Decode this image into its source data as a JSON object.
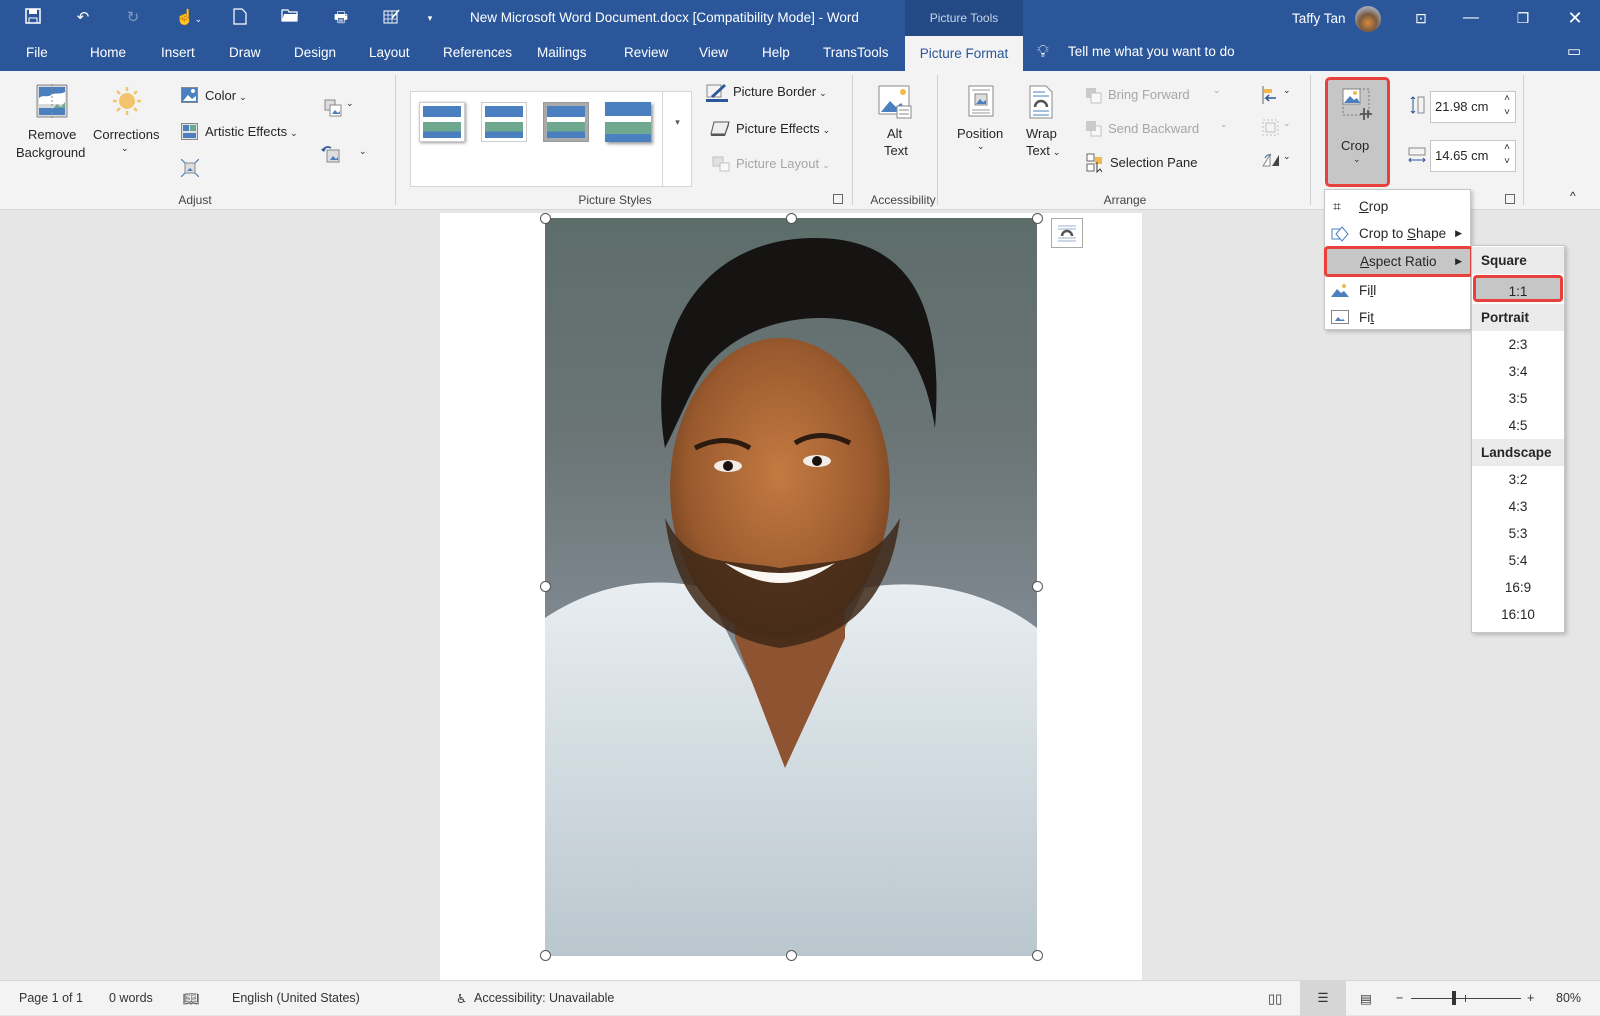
{
  "window": {
    "title": "New Microsoft Word Document.docx [Compatibility Mode]  -  Word",
    "context_tab_group": "Picture Tools",
    "user_name": "Taffy Tan"
  },
  "quick_access": [
    "save-icon",
    "undo-icon",
    "redo-icon",
    "touch-mode-icon",
    "new-document-icon",
    "open-icon",
    "print-preview-icon",
    "edit-data-icon",
    "customize-qat-icon"
  ],
  "tabs": [
    "File",
    "Home",
    "Insert",
    "Draw",
    "Design",
    "Layout",
    "References",
    "Mailings",
    "Review",
    "View",
    "Help",
    "TransTools"
  ],
  "active_tab": "Picture Format",
  "tell_me": "Tell me what you want to do",
  "ribbon": {
    "adjust": {
      "label": "Adjust",
      "remove_background": [
        "Remove",
        "Background"
      ],
      "corrections": "Corrections",
      "color": "Color",
      "artistic_effects": "Artistic Effects"
    },
    "picture_styles": {
      "label": "Picture Styles",
      "picture_border": "Picture Border",
      "picture_effects": "Picture Effects",
      "picture_layout": "Picture Layout"
    },
    "accessibility": {
      "label": "Accessibility",
      "alt_text": [
        "Alt",
        "Text"
      ]
    },
    "arrange": {
      "label": "Arrange",
      "position": "Position",
      "wrap_text": [
        "Wrap",
        "Text"
      ],
      "bring_forward": "Bring Forward",
      "send_backward": "Send Backward",
      "selection_pane": "Selection Pane"
    },
    "size": {
      "crop": "Crop",
      "height": "21.98 cm",
      "width": "14.65 cm"
    }
  },
  "crop_menu": {
    "items": [
      {
        "label": "Crop",
        "underline": "C"
      },
      {
        "label": "Crop to Shape",
        "underline": "S"
      },
      {
        "label": "Aspect Ratio",
        "underline": "A"
      },
      {
        "label": "Fill",
        "underline": "l"
      },
      {
        "label": "Fit",
        "underline": "t"
      }
    ],
    "highlighted": "Aspect Ratio"
  },
  "aspect_ratio_menu": {
    "groups": [
      {
        "heading": "Square",
        "items": [
          "1:1"
        ]
      },
      {
        "heading": "Portrait",
        "items": [
          "2:3",
          "3:4",
          "3:5",
          "4:5"
        ]
      },
      {
        "heading": "Landscape",
        "items": [
          "3:2",
          "4:3",
          "5:3",
          "5:4",
          "16:9",
          "16:10"
        ]
      }
    ],
    "highlighted": "1:1"
  },
  "status": {
    "page": "Page 1 of 1",
    "words": "0 words",
    "language": "English (United States)",
    "accessibility": "Accessibility: Unavailable",
    "zoom": "80%",
    "zoom_percent": 80
  }
}
